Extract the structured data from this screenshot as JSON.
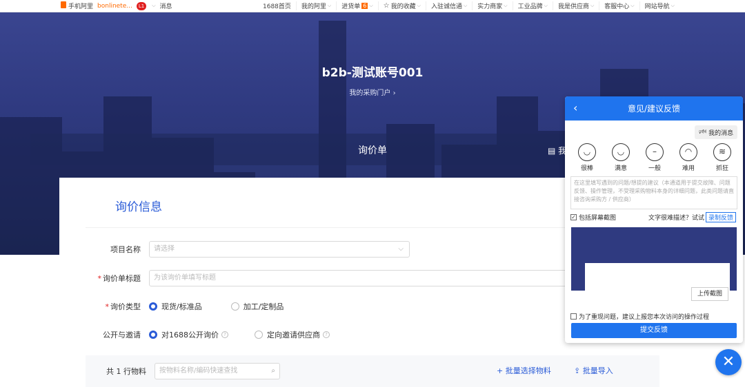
{
  "topbar": {
    "mobile": "手机阿里",
    "user": "bonlinete...",
    "level": "L1",
    "messages": "消息",
    "nav": [
      "1688首页",
      "我的阿里",
      "进货单",
      "我的收藏",
      "入驻诚信通",
      "实力商家",
      "工业品牌",
      "我是供应商",
      "客服中心",
      "网站导航"
    ],
    "cart_count": "6"
  },
  "hero": {
    "title": "b2b-测试账号001",
    "subtitle": "我的采购门户 ›",
    "section_title": "询价单",
    "section_right": "我"
  },
  "form": {
    "title": "询价信息",
    "project_label": "项目名称",
    "project_placeholder": "请选择",
    "subject_label": "询价单标题",
    "subject_placeholder": "为该询价单填写标题",
    "type_label": "询价类型",
    "type_opt1": "现货/标准品",
    "type_opt2": "加工/定制品",
    "open_label": "公开与邀请",
    "open_opt1": "对1688公开询价",
    "open_opt2": "定向邀请供应商",
    "rows_count": "共 1 行物料",
    "search_placeholder": "按物料名称/编码快速查找",
    "batch_select": "+ 批量选择物料",
    "batch_import": "批量导入"
  },
  "feedback": {
    "title": "意见/建议反馈",
    "my_messages": "我的消息",
    "faces": [
      "很棒",
      "满意",
      "一般",
      "难用",
      "抓狂"
    ],
    "textarea_placeholder": "在这里填写遇到的问题/想提的建议（本通道用于提交故障、问题反馈、操作管理，不受理采购物料本身的详细问题，此类问题请直接咨询采购方 / 供应商）",
    "include_screenshot": "包括屏幕截图",
    "hint": "文字很难描述？试试",
    "record": "录制反馈",
    "upload": "上传截图",
    "report_ops": "为了重现问题，建议上报您本次访问的操作过程",
    "submit": "提交反馈"
  }
}
